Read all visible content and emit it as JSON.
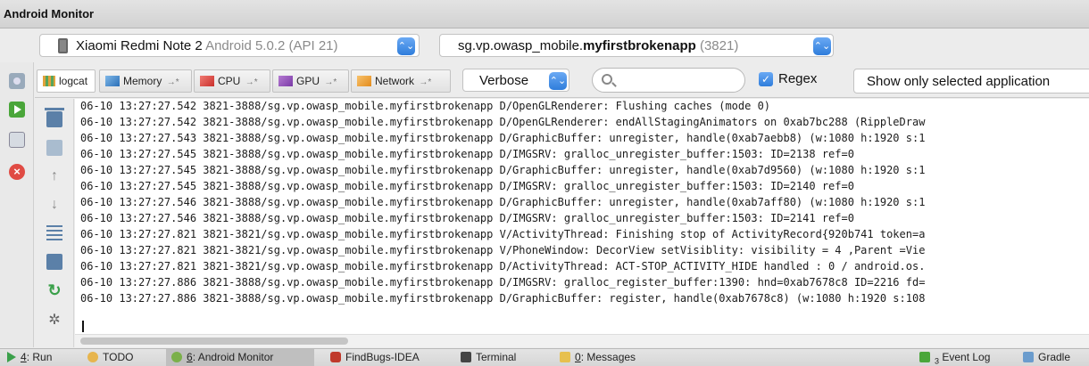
{
  "window": {
    "title": "Android Monitor"
  },
  "device_selector": {
    "name": "Xiaomi Redmi Note 2",
    "detail": "Android 5.0.2 (API 21)"
  },
  "process_selector": {
    "prefix": "sg.vp.owasp_mobile.",
    "bold": "myfirstbrokenapp",
    "pid": "(3821)"
  },
  "tabs": [
    {
      "label": "logcat",
      "icon": "logcat-icon",
      "active": true
    },
    {
      "label": "Memory",
      "icon": "memory-icon",
      "arrow": "→*"
    },
    {
      "label": "CPU",
      "icon": "cpu-icon",
      "arrow": "→*"
    },
    {
      "label": "GPU",
      "icon": "gpu-icon",
      "arrow": "→*"
    },
    {
      "label": "Network",
      "icon": "network-icon",
      "arrow": "→*"
    }
  ],
  "log_level": {
    "value": "Verbose"
  },
  "search": {
    "value": "",
    "placeholder": ""
  },
  "regex": {
    "label": "Regex",
    "checked": true
  },
  "filter": {
    "value": "Show only selected application"
  },
  "log_lines": [
    "06-10 13:27:27.542 3821-3888/sg.vp.owasp_mobile.myfirstbrokenapp D/OpenGLRenderer: Flushing caches (mode 0)",
    "06-10 13:27:27.542 3821-3888/sg.vp.owasp_mobile.myfirstbrokenapp D/OpenGLRenderer: endAllStagingAnimators on 0xab7bc288 (RippleDraw",
    "06-10 13:27:27.543 3821-3888/sg.vp.owasp_mobile.myfirstbrokenapp D/GraphicBuffer: unregister, handle(0xab7aebb8) (w:1080 h:1920 s:1",
    "06-10 13:27:27.545 3821-3888/sg.vp.owasp_mobile.myfirstbrokenapp D/IMGSRV: gralloc_unregister_buffer:1503: ID=2138 ref=0",
    "06-10 13:27:27.545 3821-3888/sg.vp.owasp_mobile.myfirstbrokenapp D/GraphicBuffer: unregister, handle(0xab7d9560) (w:1080 h:1920 s:1",
    "06-10 13:27:27.545 3821-3888/sg.vp.owasp_mobile.myfirstbrokenapp D/IMGSRV: gralloc_unregister_buffer:1503: ID=2140 ref=0",
    "06-10 13:27:27.546 3821-3888/sg.vp.owasp_mobile.myfirstbrokenapp D/GraphicBuffer: unregister, handle(0xab7aff80) (w:1080 h:1920 s:1",
    "06-10 13:27:27.546 3821-3888/sg.vp.owasp_mobile.myfirstbrokenapp D/IMGSRV: gralloc_unregister_buffer:1503: ID=2141 ref=0",
    "06-10 13:27:27.821 3821-3821/sg.vp.owasp_mobile.myfirstbrokenapp V/ActivityThread: Finishing stop of ActivityRecord{920b741 token=a",
    "06-10 13:27:27.821 3821-3821/sg.vp.owasp_mobile.myfirstbrokenapp V/PhoneWindow: DecorView setVisiblity: visibility = 4 ,Parent =Vie",
    "06-10 13:27:27.821 3821-3821/sg.vp.owasp_mobile.myfirstbrokenapp D/ActivityThread: ACT-STOP_ACTIVITY_HIDE handled : 0 / android.os.",
    "06-10 13:27:27.886 3821-3888/sg.vp.owasp_mobile.myfirstbrokenapp D/IMGSRV: gralloc_register_buffer:1390: hnd=0xab7678c8 ID=2216 fd=",
    "06-10 13:27:27.886 3821-3888/sg.vp.owasp_mobile.myfirstbrokenapp D/GraphicBuffer: register, handle(0xab7678c8) (w:1080 h:1920 s:108"
  ],
  "bottom_bar": {
    "run": {
      "num": "4",
      "rest": ": Run"
    },
    "todo": "TODO",
    "android_monitor": {
      "num": "6",
      "rest": ": Android Monitor"
    },
    "findbugs": "FindBugs-IDEA",
    "terminal": "Terminal",
    "messages": {
      "num": "0",
      "rest": ": Messages"
    },
    "event_log": {
      "count": "3",
      "label": "Event Log"
    },
    "gradle": "Gradle"
  },
  "icons": {
    "stepper": "⌃⌄",
    "checkmark": "✓",
    "up_arrow": "↑",
    "down_arrow": "↓",
    "restart": "↻",
    "settings": "✲"
  }
}
